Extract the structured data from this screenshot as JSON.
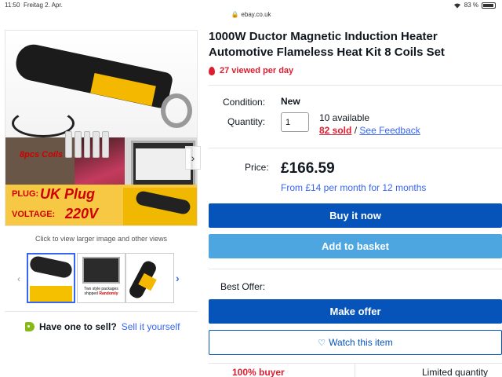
{
  "status_bar": {
    "time": "11:50",
    "date": "Freitag 2. Apr.",
    "battery": "83 %"
  },
  "url_bar": {
    "url": "ebay.co.uk"
  },
  "gallery": {
    "image_text": {
      "coils": "8pcs Coils",
      "plug_label": "PLUG:",
      "plug_value": "UK Plug",
      "voltage_label": "VOLTAGE:",
      "voltage_value": "220V"
    },
    "caption": "Click to view larger image and other views",
    "thumb2_text_line1": "Two style packages",
    "thumb2_text_line2": "shipped",
    "thumb2_text_red": "Randomly"
  },
  "sell": {
    "question": "Have one to sell?",
    "link": "Sell it yourself"
  },
  "listing": {
    "title": "1000W Ductor Magnetic Induction Heater Automotive Flameless Heat Kit 8 Coils Set",
    "viewed": "27 viewed per day",
    "condition_label": "Condition:",
    "condition_value": "New",
    "quantity_label": "Quantity:",
    "quantity_value": "1",
    "available": "10 available",
    "sold": "82 sold",
    "separator": "/",
    "feedback": "See Feedback",
    "price_label": "Price:",
    "price": "£166.59",
    "monthly": "From £14 per month for 12 months",
    "buy_now": "Buy it now",
    "add_to_basket": "Add to basket",
    "best_offer_label": "Best Offer:",
    "make_offer": "Make offer",
    "watch": "Watch this item",
    "bottom_left": "100% buyer",
    "bottom_right": "Limited quantity"
  },
  "colors": {
    "primary_blue": "#0654ba",
    "light_blue": "#4da6e0",
    "link_blue": "#3665f3",
    "red": "#dd1e31"
  }
}
